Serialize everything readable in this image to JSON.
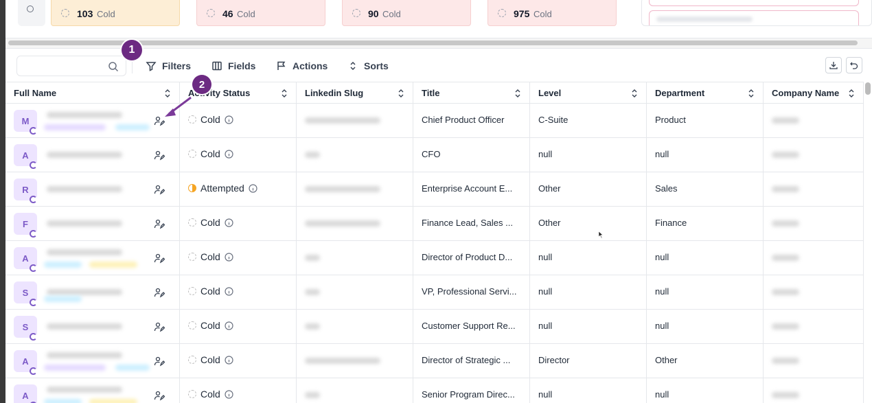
{
  "cards": [
    {
      "count": "103",
      "label": "Cold",
      "bg": "#fdeed6"
    },
    {
      "count": "46",
      "label": "Cold",
      "bg": "#fde8e8"
    },
    {
      "count": "90",
      "label": "Cold",
      "bg": "#fde8e8"
    },
    {
      "count": "975",
      "label": "Cold",
      "bg": "#fde8e8"
    }
  ],
  "toolbar": {
    "search_placeholder": "",
    "filters": "Filters",
    "fields": "Fields",
    "actions": "Actions",
    "sorts": "Sorts"
  },
  "columns": [
    "Full Name",
    "Activity Status",
    "Linkedin Slug",
    "Title",
    "Level",
    "Department",
    "Company Name"
  ],
  "rows": [
    {
      "initial": "M",
      "status": "Cold",
      "title": "Chief Product Officer",
      "level": "C-Suite",
      "department": "Product"
    },
    {
      "initial": "A",
      "status": "Cold",
      "title": "CFO",
      "level": "null",
      "department": "null"
    },
    {
      "initial": "R",
      "status": "Attempted",
      "title": "Enterprise Account E...",
      "level": "Other",
      "department": "Sales"
    },
    {
      "initial": "F",
      "status": "Cold",
      "title": "Finance Lead, Sales ...",
      "level": "Other",
      "department": "Finance"
    },
    {
      "initial": "A",
      "status": "Cold",
      "title": "Director of Product D...",
      "level": "null",
      "department": "null"
    },
    {
      "initial": "S",
      "status": "Cold",
      "title": "VP, Professional Servi...",
      "level": "null",
      "department": "null"
    },
    {
      "initial": "S",
      "status": "Cold",
      "title": "Customer Support Re...",
      "level": "null",
      "department": "null"
    },
    {
      "initial": "A",
      "status": "Cold",
      "title": "Director of Strategic ...",
      "level": "Director",
      "department": "Other"
    },
    {
      "initial": "A",
      "status": "Cold",
      "title": "Senior Program Direc...",
      "level": "null",
      "department": "null"
    }
  ],
  "annotations": {
    "one": "1",
    "two": "2"
  },
  "colors": {
    "accent": "#6c2a82",
    "avatar_bg": "#ede4ff",
    "avatar_fg": "#7c5ac7",
    "attempted": "#f5a524"
  }
}
